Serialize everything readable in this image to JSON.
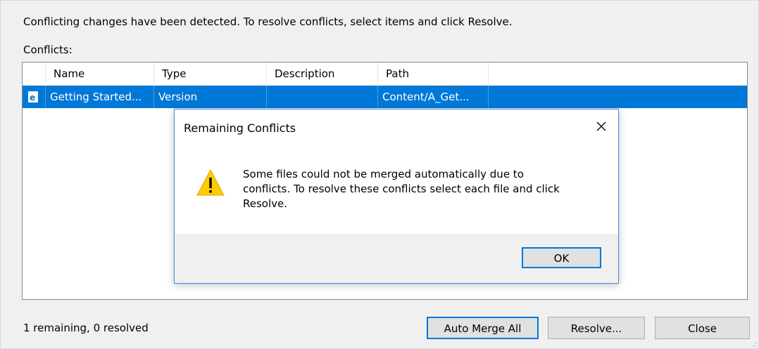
{
  "window": {
    "instruction": "Conflicting changes have been detected.  To resolve conflicts, select items and click Resolve.",
    "conflicts_label": "Conflicts:",
    "status": "1 remaining, 0 resolved"
  },
  "table": {
    "columns": [
      "Name",
      "Type",
      "Description",
      "Path"
    ],
    "rows": [
      {
        "icon": "document-icon",
        "name": "Getting Started...",
        "type": "Version",
        "description": "",
        "path": "Content/A_Get..."
      }
    ]
  },
  "buttons": {
    "auto_merge": "Auto Merge All",
    "resolve": "Resolve...",
    "close": "Close"
  },
  "dialog": {
    "title": "Remaining Conflicts",
    "message": "Some files could not be merged automatically due to\nconflicts.  To resolve these conflicts select each file and click\nResolve.",
    "ok": "OK",
    "icon": "warning-icon"
  },
  "colors": {
    "selection": "#0078d7",
    "accent_border": "#0078d7",
    "warning": "#ffcc00"
  }
}
